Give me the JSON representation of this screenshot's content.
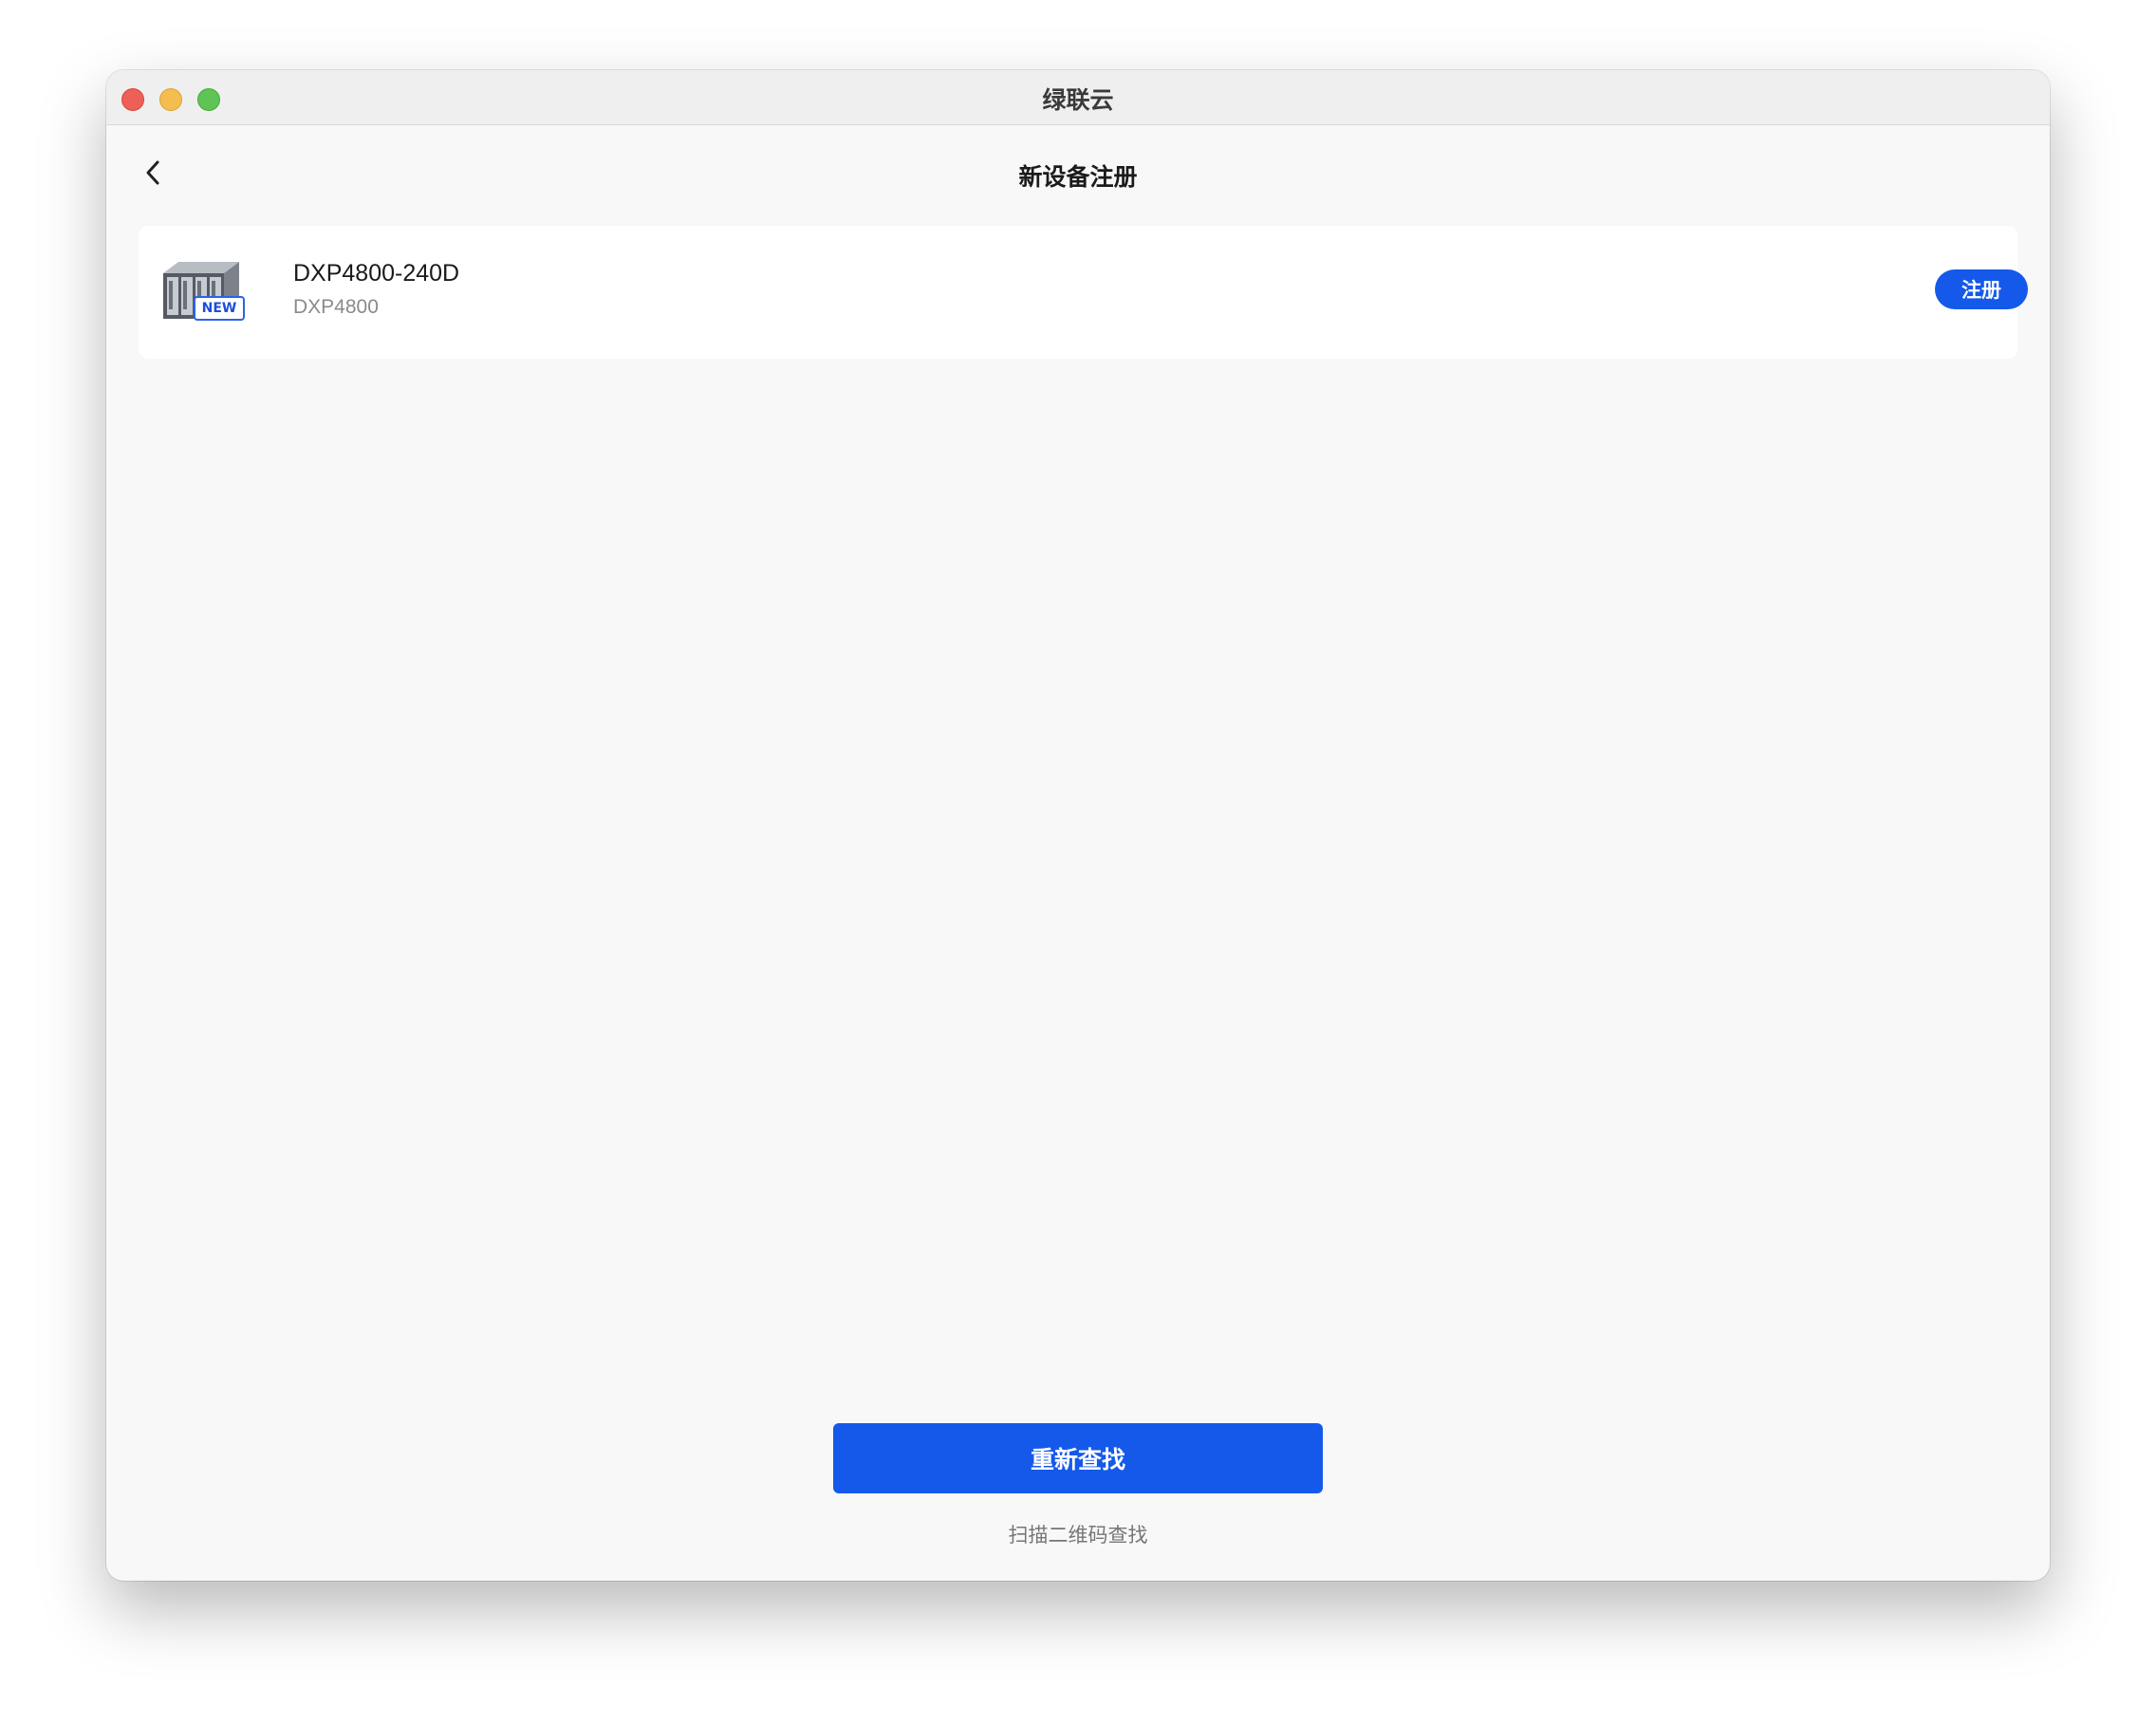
{
  "window": {
    "title": "绿联云",
    "controls": [
      "close",
      "minimize",
      "zoom"
    ]
  },
  "nav": {
    "back_icon": "chevron-left-icon",
    "title": "新设备注册"
  },
  "device": {
    "name": "DXP4800-240D",
    "model": "DXP4800",
    "badge": "NEW",
    "image": "nas-device-icon",
    "register_label": "注册"
  },
  "actions": {
    "research_label": "重新查找",
    "scan_label": "扫描二维码查找"
  },
  "colors": {
    "accent": "#1559ea",
    "background": "#f8f8f9",
    "card": "#ffffff",
    "close": "#ee5f57",
    "minimize": "#f4bd4f",
    "zoom": "#5ec454"
  }
}
